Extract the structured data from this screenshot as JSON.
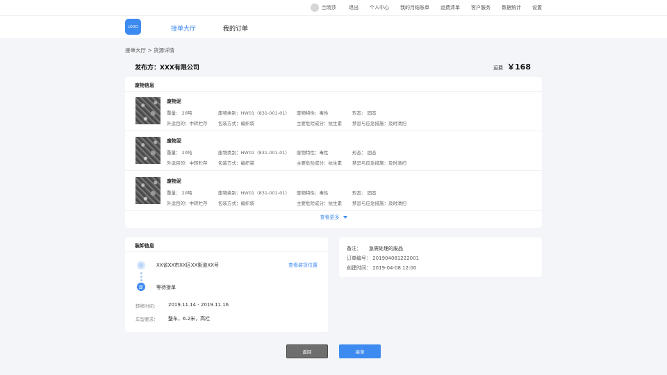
{
  "topbar": {
    "user": "兰晓莎",
    "links": [
      "退出",
      "个人中心",
      "我的月结账单",
      "运费清单",
      "客户服务",
      "数据统计",
      "设置"
    ]
  },
  "header": {
    "logo": "LOGO",
    "nav": [
      "接单大厅",
      "我的订单"
    ]
  },
  "breadcrumb": "接单大厅 > 货源详情",
  "publisher": "发布方：XXX有限公司",
  "fee": {
    "label": "运费",
    "amount": "￥168"
  },
  "waste_section": {
    "title": "废物信息",
    "items": [
      {
        "name": "废物泥",
        "weight": "重量：  20吨",
        "category": "废物类别：HW01（831-001-01）",
        "property": "废物特性：毒性",
        "form": "形态：  固态",
        "purpose": "外运目的：中转贮存",
        "packaging": "包装方式：编织袋",
        "component": "主要危险成分：抗生素",
        "emergency": "禁忌与应急措施：及时清扫"
      },
      {
        "name": "废物泥",
        "weight": "重量：  20吨",
        "category": "废物类别：HW01（831-001-01）",
        "property": "废物特性：毒性",
        "form": "形态：  固态",
        "purpose": "外运目的：中转贮存",
        "packaging": "包装方式：编织袋",
        "component": "主要危险成分：抗生素",
        "emergency": "禁忌与应急措施：及时清扫"
      },
      {
        "name": "废物泥",
        "weight": "重量：  20吨",
        "category": "废物类别：HW01（831-001-01）",
        "property": "废物特性：毒性",
        "form": "形态：  固态",
        "purpose": "外运目的：中转贮存",
        "packaging": "包装方式：编织袋",
        "component": "主要危险成分：抗生素",
        "emergency": "禁忌与应急措施：及时清扫"
      }
    ],
    "more": "查看更多"
  },
  "load_section": {
    "title": "装卸信息",
    "address": "XX省XX市XX区XX街道XX号",
    "view_location": "查看装货位置",
    "unload_marker": "卸",
    "unload_text": "等待接单",
    "transfer_label": "转移时间：",
    "transfer_value": "2019.11.14 - 2019.11.16",
    "vehicle_label": "车型要求：",
    "vehicle_value": "整车，6.2米，高栏"
  },
  "order_info": {
    "remark_label": "备注：",
    "remark_value": "急需处理的废品",
    "order_no": "订单编号：  201904081222001",
    "created": "创建时间：  2019-04-08  12:00"
  },
  "buttons": {
    "back": "返回",
    "take": "接单"
  },
  "colors": {
    "accent": "#3d8af0",
    "bg": "#f3f5f9",
    "back_button": "#6e6e6e"
  },
  "icons": [
    "avatar-icon",
    "caret-down-icon",
    "location-dot-icon"
  ]
}
